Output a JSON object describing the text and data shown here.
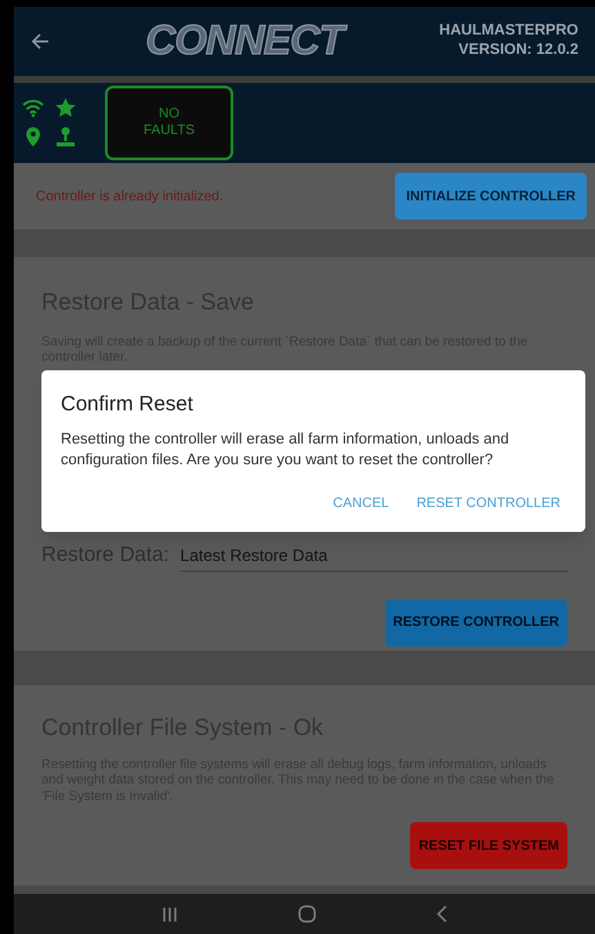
{
  "header": {
    "logo": "CONNECT",
    "device": "HAULMASTERPRO",
    "version": "VERSION: 12.0.2"
  },
  "status": {
    "fault_badge": "NO FAULTS"
  },
  "init": {
    "message": "Controller is already initialized.",
    "button": "INITIALIZE CONTROLLER"
  },
  "restore_card": {
    "title": "Restore Data - Save",
    "description": "Saving will create a backup of the current `Restore Data` that can be restored to the controller later.",
    "field_label": "Restore Data:",
    "field_value": "Latest Restore Data",
    "button": "RESTORE CONTROLLER"
  },
  "file_system_card": {
    "title": "Controller File System - Ok",
    "description": "Resetting the controller file systems will erase all debug logs, farm information, unloads and weight data stored on the controller. This may need to be done in the case when the 'File System is Invalid'.",
    "button": "RESET FILE SYSTEM"
  },
  "dialog": {
    "title": "Confirm Reset",
    "message": "Resetting the controller will erase all farm information, unloads and configuration files. Are you sure you want to reset the controller?",
    "actions": [
      "CANCEL",
      "RESET CONTROLLER"
    ]
  }
}
